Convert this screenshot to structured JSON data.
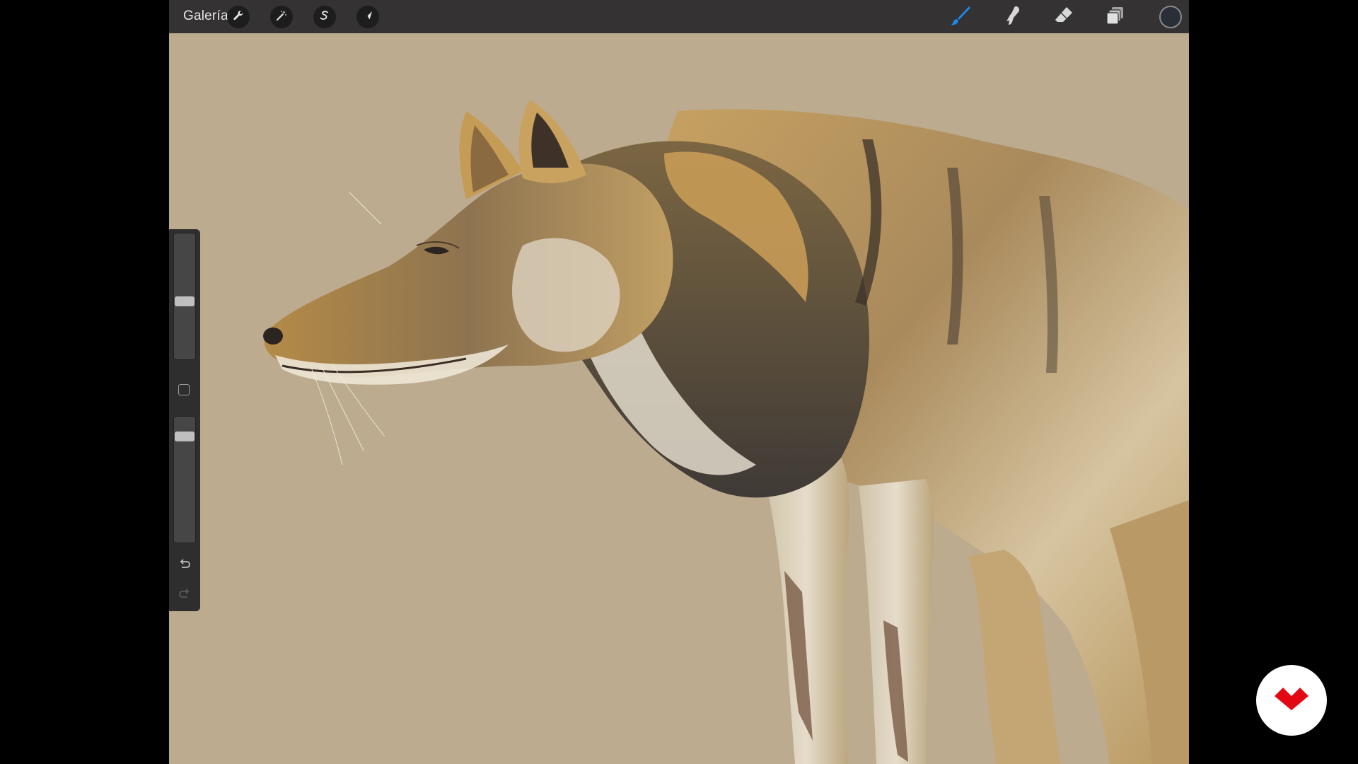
{
  "app": {
    "gallery_label": "Galería",
    "background_color": "#bcab8f",
    "toolbar_color": "#343232",
    "accent_color": "#1e88e5",
    "current_color": "#2a2e36"
  },
  "toolbar": {
    "left_tools": [
      {
        "name": "actions",
        "icon": "wrench-icon"
      },
      {
        "name": "adjustments",
        "icon": "magic-wand-icon"
      },
      {
        "name": "selection",
        "icon": "selection-s-icon"
      },
      {
        "name": "transform",
        "icon": "arrow-cursor-icon"
      }
    ],
    "right_tools": [
      {
        "name": "brush",
        "icon": "brush-icon",
        "active": true
      },
      {
        "name": "smudge",
        "icon": "smudge-finger-icon"
      },
      {
        "name": "eraser",
        "icon": "eraser-icon"
      },
      {
        "name": "layers",
        "icon": "layers-icon"
      }
    ]
  },
  "sidebar": {
    "brush_size_level": 0.55,
    "opacity_level": 0.93,
    "undo_icon": "undo-icon",
    "redo_icon": "redo-icon"
  },
  "canvas": {
    "subject": "wolf-illustration"
  },
  "overlay": {
    "logo_icon": "red-logo-icon",
    "logo_color": "#e30613"
  }
}
